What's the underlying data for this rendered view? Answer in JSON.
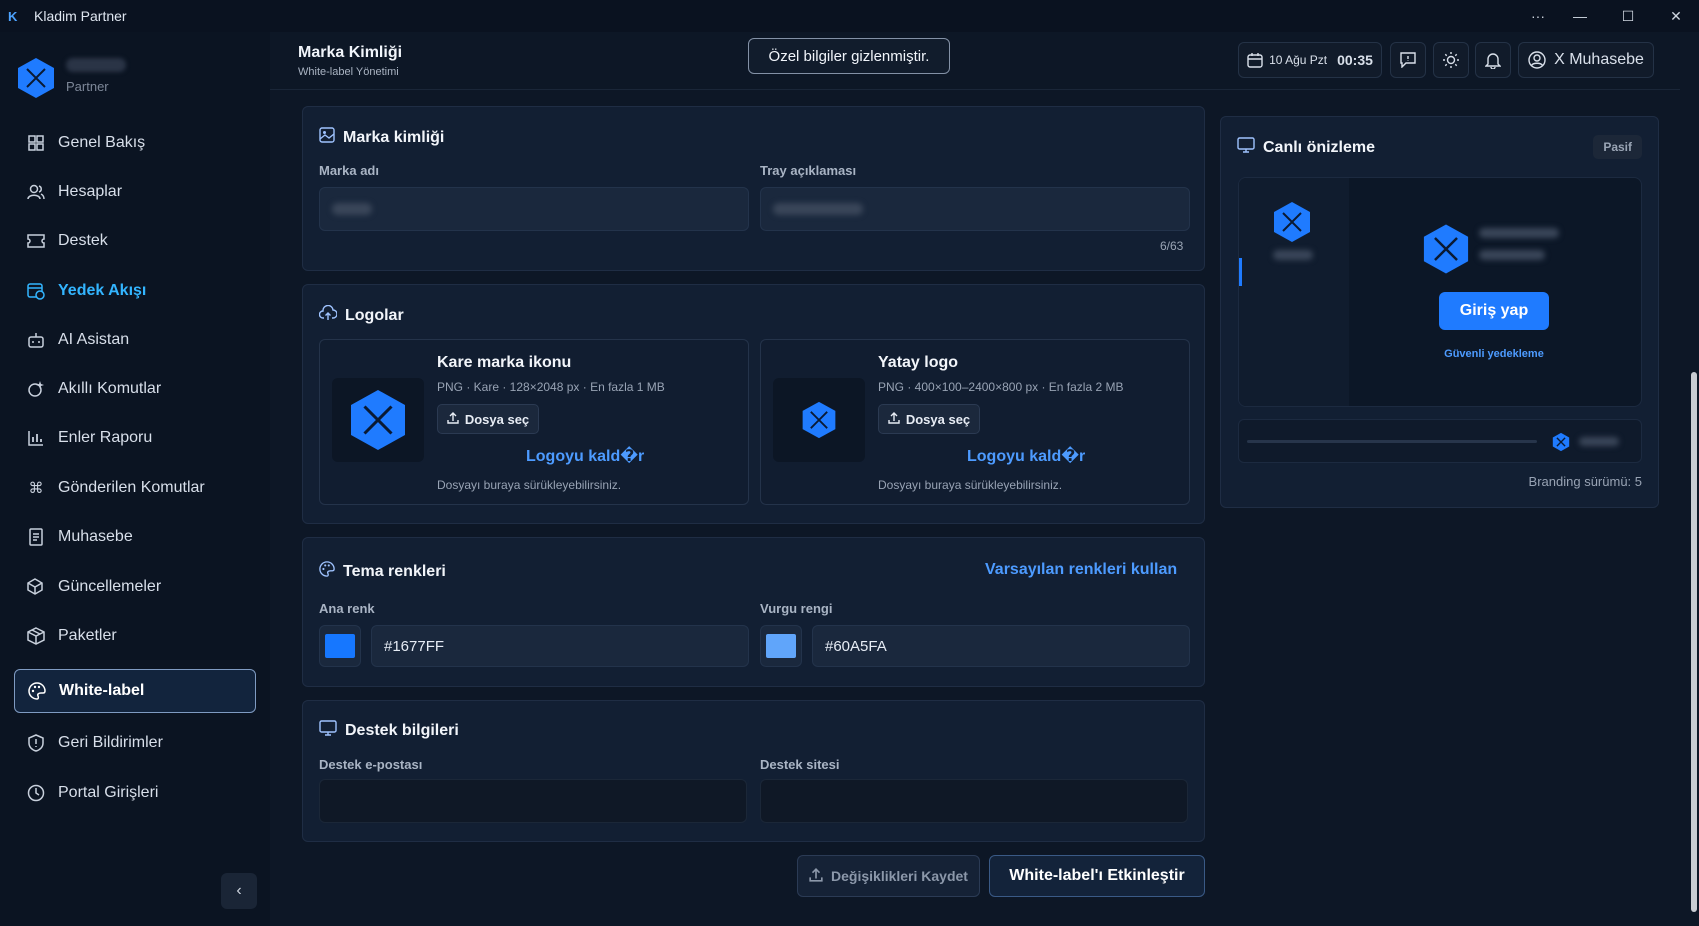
{
  "window": {
    "title": "Kladim Partner",
    "controls": [
      "···",
      "—",
      "☐",
      "✕"
    ]
  },
  "sidebar": {
    "brand_sub": "Partner",
    "items": [
      {
        "label": "Genel Bakış",
        "icon": "grid-icon"
      },
      {
        "label": "Hesaplar",
        "icon": "users-icon"
      },
      {
        "label": "Destek",
        "icon": "ticket-icon"
      },
      {
        "label": "Yedek Akışı",
        "icon": "backup-icon"
      },
      {
        "label": "AI Asistan",
        "icon": "robot-icon"
      },
      {
        "label": "Akıllı Komutlar",
        "icon": "smart-command-icon"
      },
      {
        "label": "Enler Raporu",
        "icon": "bar-chart-icon"
      },
      {
        "label": "Gönderilen Komutlar",
        "icon": "command-icon"
      },
      {
        "label": "Muhasebe",
        "icon": "ledger-icon"
      },
      {
        "label": "Güncellemeler",
        "icon": "package-update-icon"
      },
      {
        "label": "Paketler",
        "icon": "packages-icon"
      },
      {
        "label": "White-label",
        "icon": "palette-icon"
      },
      {
        "label": "Geri Bildirimler",
        "icon": "shield-feedback-icon"
      },
      {
        "label": "Portal Girişleri",
        "icon": "clock-icon"
      }
    ]
  },
  "header": {
    "title": "Marka Kimliği",
    "subtitle": "White-label Yönetimi",
    "privacy_notice": "Özel bilgiler gizlenmiştir.",
    "date": "10 Ağu Pzt",
    "time": "00:35",
    "user": "X Muhasebe"
  },
  "brand_card": {
    "title": "Marka kimliği",
    "brand_name_label": "Marka adı",
    "tray_label": "Tray açıklaması",
    "counter": "6/63"
  },
  "logos_card": {
    "title": "Logolar",
    "square": {
      "name": "Kare marka ikonu",
      "meta": "PNG · Kare · 128×2048 px · En fazla 1 MB",
      "file_btn": "Dosya seç",
      "remove": "Logoyu kald�r",
      "hint": "Dosyayı buraya sürükleyebilirsiniz."
    },
    "horizontal": {
      "name": "Yatay logo",
      "meta": "PNG · 400×100–2400×800 px · En fazla 2 MB",
      "file_btn": "Dosya seç",
      "remove": "Logoyu kald�r",
      "hint": "Dosyayı buraya sürükleyebilirsiniz."
    }
  },
  "theme_card": {
    "title": "Tema renkleri",
    "reset_link": "Varsayılan renkleri kullan",
    "primary_label": "Ana renk",
    "primary_value": "#1677FF",
    "accent_label": "Vurgu rengi",
    "accent_value": "#60A5FA"
  },
  "support_card": {
    "title": "Destek bilgileri",
    "email_label": "Destek e-postası",
    "site_label": "Destek sitesi"
  },
  "actions": {
    "save": "Değişiklikleri Kaydet",
    "activate": "White-label'ı Etkinleştir"
  },
  "preview": {
    "title": "Canlı önizleme",
    "badge": "Pasif",
    "login": "Giriş yap",
    "secure": "Güvenli yedekleme",
    "version": "Branding sürümü: 5"
  },
  "colors": {
    "primary": "#1677FF",
    "accent": "#60A5FA",
    "link": "#4d9bff"
  }
}
